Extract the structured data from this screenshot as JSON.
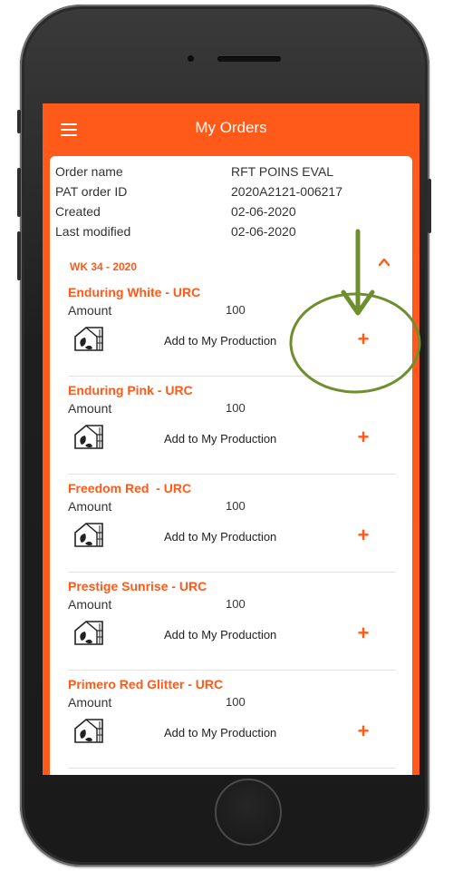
{
  "app": {
    "title": "My Orders"
  },
  "order": {
    "rows": [
      {
        "label": "Order name",
        "value": "RFT POINS EVAL"
      },
      {
        "label": "PAT order ID",
        "value": "2020A2121-006217"
      },
      {
        "label": "Created",
        "value": "02-06-2020"
      },
      {
        "label": "Last modified",
        "value": "02-06-2020"
      }
    ]
  },
  "week": {
    "label": "WK 34 - 2020"
  },
  "items": [
    {
      "name": "Enduring White - URC",
      "amount_label": "Amount",
      "amount": "100",
      "action": "Add to My Production"
    },
    {
      "name": "Enduring Pink - URC",
      "amount_label": "Amount",
      "amount": "100",
      "action": "Add to My Production"
    },
    {
      "name": "Freedom Red  - URC",
      "amount_label": "Amount",
      "amount": "100",
      "action": "Add to My Production"
    },
    {
      "name": "Prestige Sunrise - URC",
      "amount_label": "Amount",
      "amount": "100",
      "action": "Add to My Production"
    },
    {
      "name": "Primero Red Glitter - URC",
      "amount_label": "Amount",
      "amount": "100",
      "action": "Add to My Production"
    }
  ],
  "icons": {
    "menu": "hamburger-menu-icon",
    "collapse": "chevron-up-icon",
    "greenhouse": "greenhouse-icon",
    "add": "plus-icon",
    "annotation_arrow": "arrow-down-icon"
  },
  "colors": {
    "accent": "#ff5a1a",
    "annotation": "#6f8f2e",
    "background": "#ffffff"
  }
}
